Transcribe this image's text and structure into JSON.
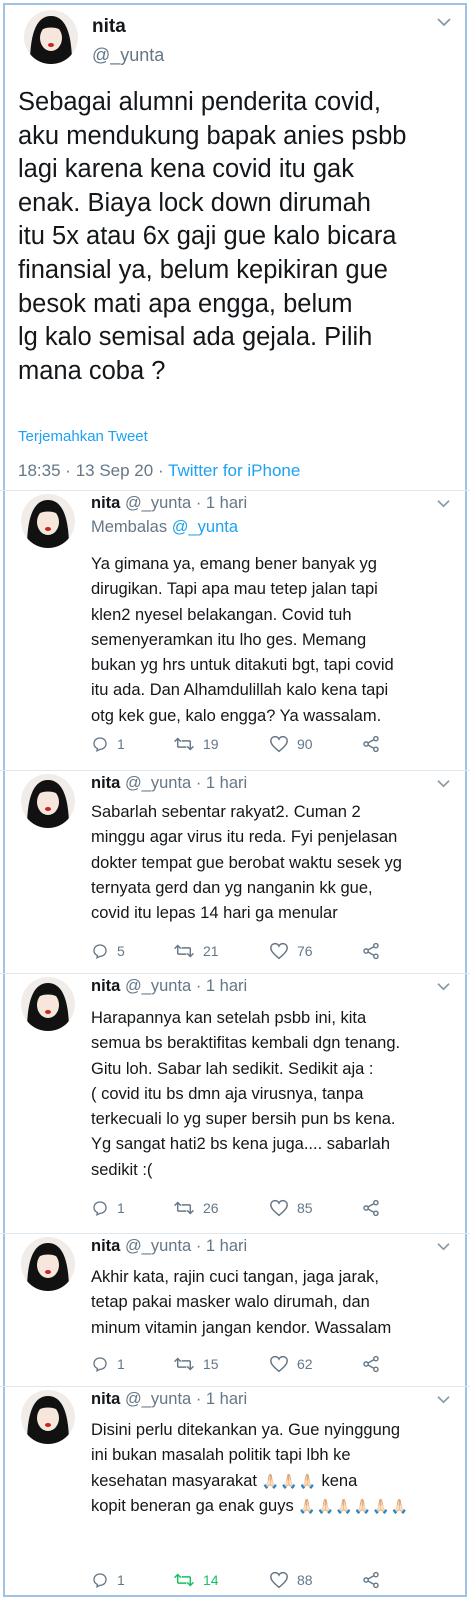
{
  "colors": {
    "accent": "#1da1f2",
    "muted": "#657786",
    "text": "#14171a",
    "retweet_active": "#17bf63",
    "frame": "#9ec3e6"
  },
  "main_tweet": {
    "name": "nita",
    "handle": "@_yunta",
    "text": "Sebagai alumni penderita covid,\naku mendukung bapak anies psbb\nlagi karena kena covid itu gak\nenak. Biaya lock down dirumah\nitu 5x atau 6x gaji gue kalo bicara\nfinansial ya, belum kepikiran gue\nbesok mati apa engga, belum\nlg kalo semisal ada gejala. Pilih\nmana coba ?",
    "translate_label": "Terjemahkan Tweet",
    "time": "18:35",
    "date": "13 Sep 20",
    "via": "Twitter for iPhone",
    "icons": {
      "more": "chevron-down-icon"
    }
  },
  "replies": [
    {
      "name": "nita",
      "handle": "@_yunta",
      "time": "1 hari",
      "replying_prefix": "Membalas",
      "replying_to": "@_yunta",
      "text": "Ya gimana ya, emang bener banyak yg\ndirugikan. Tapi apa mau tetep jalan tapi\nklen2 nyesel belakangan. Covid tuh\nsemenyeramkan itu lho ges. Memang\nbukan yg hrs untuk ditakuti bgt, tapi covid\nitu ada. Dan Alhamdulillah kalo kena tapi\notg kek gue, kalo engga? Ya wassalam.",
      "replies": "1",
      "retweets": "19",
      "likes": "90"
    },
    {
      "name": "nita",
      "handle": "@_yunta",
      "time": "1 hari",
      "text": "Sabarlah sebentar rakyat2. Cuman 2\nminggu agar virus itu reda. Fyi penjelasan\ndokter tempat gue berobat waktu sesek yg\nternyata gerd dan yg nanganin kk gue,\ncovid itu lepas 14 hari ga menular",
      "replies": "5",
      "retweets": "21",
      "likes": "76"
    },
    {
      "name": "nita",
      "handle": "@_yunta",
      "time": "1 hari",
      "text": "Harapannya kan setelah psbb ini, kita\nsemua bs beraktifitas kembali dgn tenang.\nGitu loh. Sabar lah sedikit. Sedikit aja :\n( covid itu bs dmn aja virusnya, tanpa\nterkecuali lo yg super bersih pun bs kena.\nYg sangat hati2 bs kena juga.... sabarlah\nsedikit :(",
      "replies": "1",
      "retweets": "26",
      "likes": "85"
    },
    {
      "name": "nita",
      "handle": "@_yunta",
      "time": "1 hari",
      "text": "Akhir kata, rajin cuci tangan, jaga jarak,\ntetap pakai masker walo dirumah, dan\nminum vitamin jangan kendor. Wassalam",
      "replies": "1",
      "retweets": "15",
      "likes": "62"
    },
    {
      "name": "nita",
      "handle": "@_yunta",
      "time": "1 hari",
      "text_line1": "Disini perlu ditekankan ya. Gue nyinggung",
      "text_line2": "ini bukan masalah politik tapi lbh ke",
      "text_line3a": "kesehatan masyarakat",
      "emoji_a": "🙏🏻🙏🏻🙏🏻",
      "text_line3b": "kena",
      "text_line4": "kopit beneran ga enak guys",
      "emoji_b": "🙏🏻🙏🏻🙏🏻🙏🏻🙏🏻🙏🏻",
      "replies": "1",
      "retweets": "14",
      "likes": "88"
    }
  ]
}
